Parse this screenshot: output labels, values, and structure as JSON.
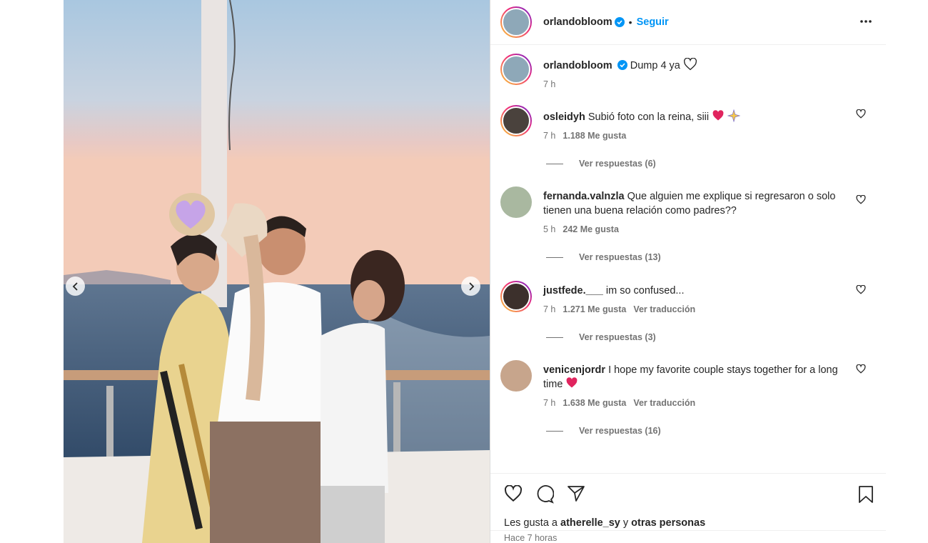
{
  "header": {
    "username": "orlandobloom",
    "separator": "•",
    "follow_label": "Seguir",
    "more_icon": "more-horizontal-icon"
  },
  "caption": {
    "username": "orlandobloom",
    "text": "Dump 4 ya",
    "time": "7 h"
  },
  "comments": [
    {
      "username": "osleidyh",
      "text": "Subió foto con la reina, siii",
      "time": "7 h",
      "likes": "1.188 Me gusta",
      "translate": "",
      "replies": "Ver respuestas (6)"
    },
    {
      "username": "fernanda.valnzla",
      "text": "Que alguien me explique si regresaron o solo tienen una buena relación como padres?? ",
      "time": "5 h",
      "likes": "242 Me gusta",
      "translate": "",
      "replies": "Ver respuestas (13)"
    },
    {
      "username": "justfede.___",
      "text": "im so confused...",
      "time": "7 h",
      "likes": "1.271 Me gusta",
      "translate": "Ver traducción",
      "replies": "Ver respuestas (3)"
    },
    {
      "username": "venicenjordr",
      "text": "I hope my favorite couple stays together for a long time",
      "time": "7 h",
      "likes": "1.638 Me gusta",
      "translate": "Ver traducción",
      "replies": "Ver respuestas (16)"
    }
  ],
  "likes_prefix": "Les gusta a",
  "likes_user": "atherelle_sy",
  "likes_connector": "y",
  "likes_suffix": "otras personas",
  "posted_ago": "Hace 7 horas",
  "colors": {
    "accent": "#0095f6",
    "verified": "#0095f6",
    "heart_red": "#e0245e"
  }
}
